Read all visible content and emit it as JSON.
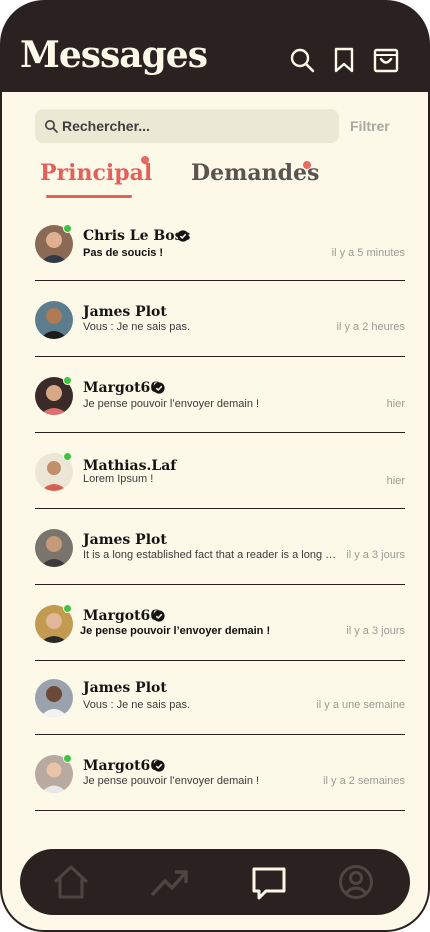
{
  "header": {
    "title": "Messages",
    "icons": [
      "search-icon",
      "bookmark-icon",
      "shopping-bag-icon"
    ]
  },
  "search": {
    "placeholder": "Rechercher...",
    "filter_label": "Filtrer"
  },
  "tabs": [
    {
      "label": "Principal",
      "active": true,
      "notification": true
    },
    {
      "label": "Demandes",
      "active": false,
      "notification": true
    }
  ],
  "colors": {
    "dark": "#2a2220",
    "cream": "#fcf9e8",
    "accent": "#e4605a",
    "online": "#3ec43e"
  },
  "conversations": [
    {
      "name": "Chris Le Boss",
      "verified": true,
      "online": true,
      "preview": "Pas de soucis !",
      "unread": true,
      "time": "il y a 5 minutes",
      "avatar_bg": "#8a6a55"
    },
    {
      "name": "James Plot",
      "verified": false,
      "online": false,
      "preview": "Vous : Je ne sais pas.",
      "unread": false,
      "time": "il y a 2 heures",
      "avatar_bg": "#5b7d8e"
    },
    {
      "name": "Margot66",
      "verified": true,
      "online": true,
      "preview": "Je pense pouvoir l’envoyer demain !",
      "unread": false,
      "time": "hier",
      "avatar_bg": "#3a2a28"
    },
    {
      "name": "Mathias.Laf",
      "verified": false,
      "online": true,
      "preview": "Lorem Ipsum !",
      "unread": false,
      "time": "hier",
      "avatar_bg": "#d86050"
    },
    {
      "name": "James Plot",
      "verified": false,
      "online": false,
      "preview": "It is a long established fact that a reader is a long established fact",
      "unread": false,
      "time": "il y a 3 jours",
      "avatar_bg": "#7a756c"
    },
    {
      "name": "Margot66",
      "verified": true,
      "online": true,
      "preview": "Je pense pouvoir l’envoyer demain !",
      "unread": true,
      "time": "il y a 3 jours",
      "avatar_bg": "#c29a50"
    },
    {
      "name": "James Plot",
      "verified": false,
      "online": false,
      "preview": "Vous : Je ne sais pas.",
      "unread": false,
      "time": "il y a une semaine",
      "avatar_bg": "#9aa3ad"
    },
    {
      "name": "Margot66",
      "verified": true,
      "online": true,
      "preview": "Je pense pouvoir l’envoyer demain !",
      "unread": false,
      "time": "il y a 2 semaines",
      "avatar_bg": "#b8aaa0"
    }
  ],
  "bottom_nav": [
    {
      "icon": "home-icon",
      "active": false
    },
    {
      "icon": "trending-icon",
      "active": false
    },
    {
      "icon": "chat-icon",
      "active": true
    },
    {
      "icon": "profile-icon",
      "active": false
    }
  ]
}
